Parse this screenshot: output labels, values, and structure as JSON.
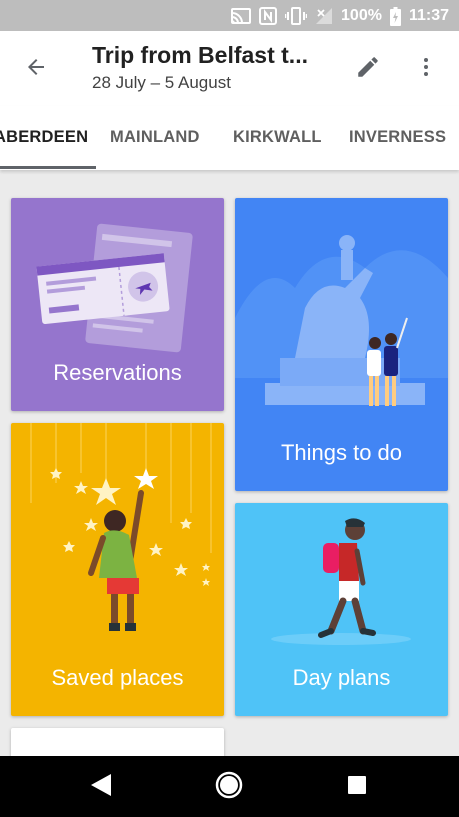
{
  "status_bar": {
    "battery_percent": "100%",
    "time": "11:37",
    "icons": [
      "cast-icon",
      "nfc-icon",
      "vibrate-icon",
      "no-signal-icon",
      "battery-charging-icon"
    ]
  },
  "app_bar": {
    "title": "Trip from Belfast t...",
    "subtitle": "28 July – 5 August",
    "back_icon": "arrow-back-icon",
    "edit_icon": "pencil-icon",
    "more_icon": "more-vert-icon"
  },
  "tabs": [
    {
      "label": "ABERDEEN",
      "active": true
    },
    {
      "label": "MAINLAND",
      "active": false
    },
    {
      "label": "KIRKWALL",
      "active": false
    },
    {
      "label": "INVERNESS",
      "active": false
    }
  ],
  "cards": {
    "reservations": {
      "label": "Reservations",
      "color": "#9575cd"
    },
    "things_to_do": {
      "label": "Things to do",
      "color": "#4285f4"
    },
    "saved_places": {
      "label": "Saved places",
      "color": "#f4b400"
    },
    "day_plans": {
      "label": "Day plans",
      "color": "#4fc3f7"
    }
  },
  "nav_bar": {
    "back_icon": "triangle-back-icon",
    "home_icon": "circle-home-icon",
    "recents_icon": "square-recents-icon"
  }
}
